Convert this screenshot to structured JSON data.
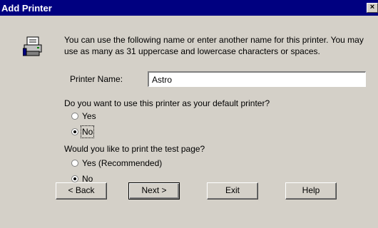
{
  "window": {
    "title": "Add Printer",
    "close_label": "×"
  },
  "intro_text": "You can use the following name or enter another name for this printer. You may use as many as 31 uppercase and lowercase characters or spaces.",
  "printer_name": {
    "label": "Printer Name:",
    "value": "Astro"
  },
  "default_question": {
    "text": "Do you want to use this printer as your default printer?",
    "options": [
      {
        "label": "Yes",
        "selected": false
      },
      {
        "label": "No",
        "selected": true
      }
    ]
  },
  "test_page_question": {
    "text": "Would you like to print the test page?",
    "options": [
      {
        "label": "Yes (Recommended)",
        "selected": false
      },
      {
        "label": "No",
        "selected": true
      }
    ]
  },
  "buttons": {
    "back": "< Back",
    "next": "Next >",
    "exit": "Exit",
    "help": "Help"
  },
  "colors": {
    "titlebar": "#000080",
    "face": "#d4d0c8"
  }
}
